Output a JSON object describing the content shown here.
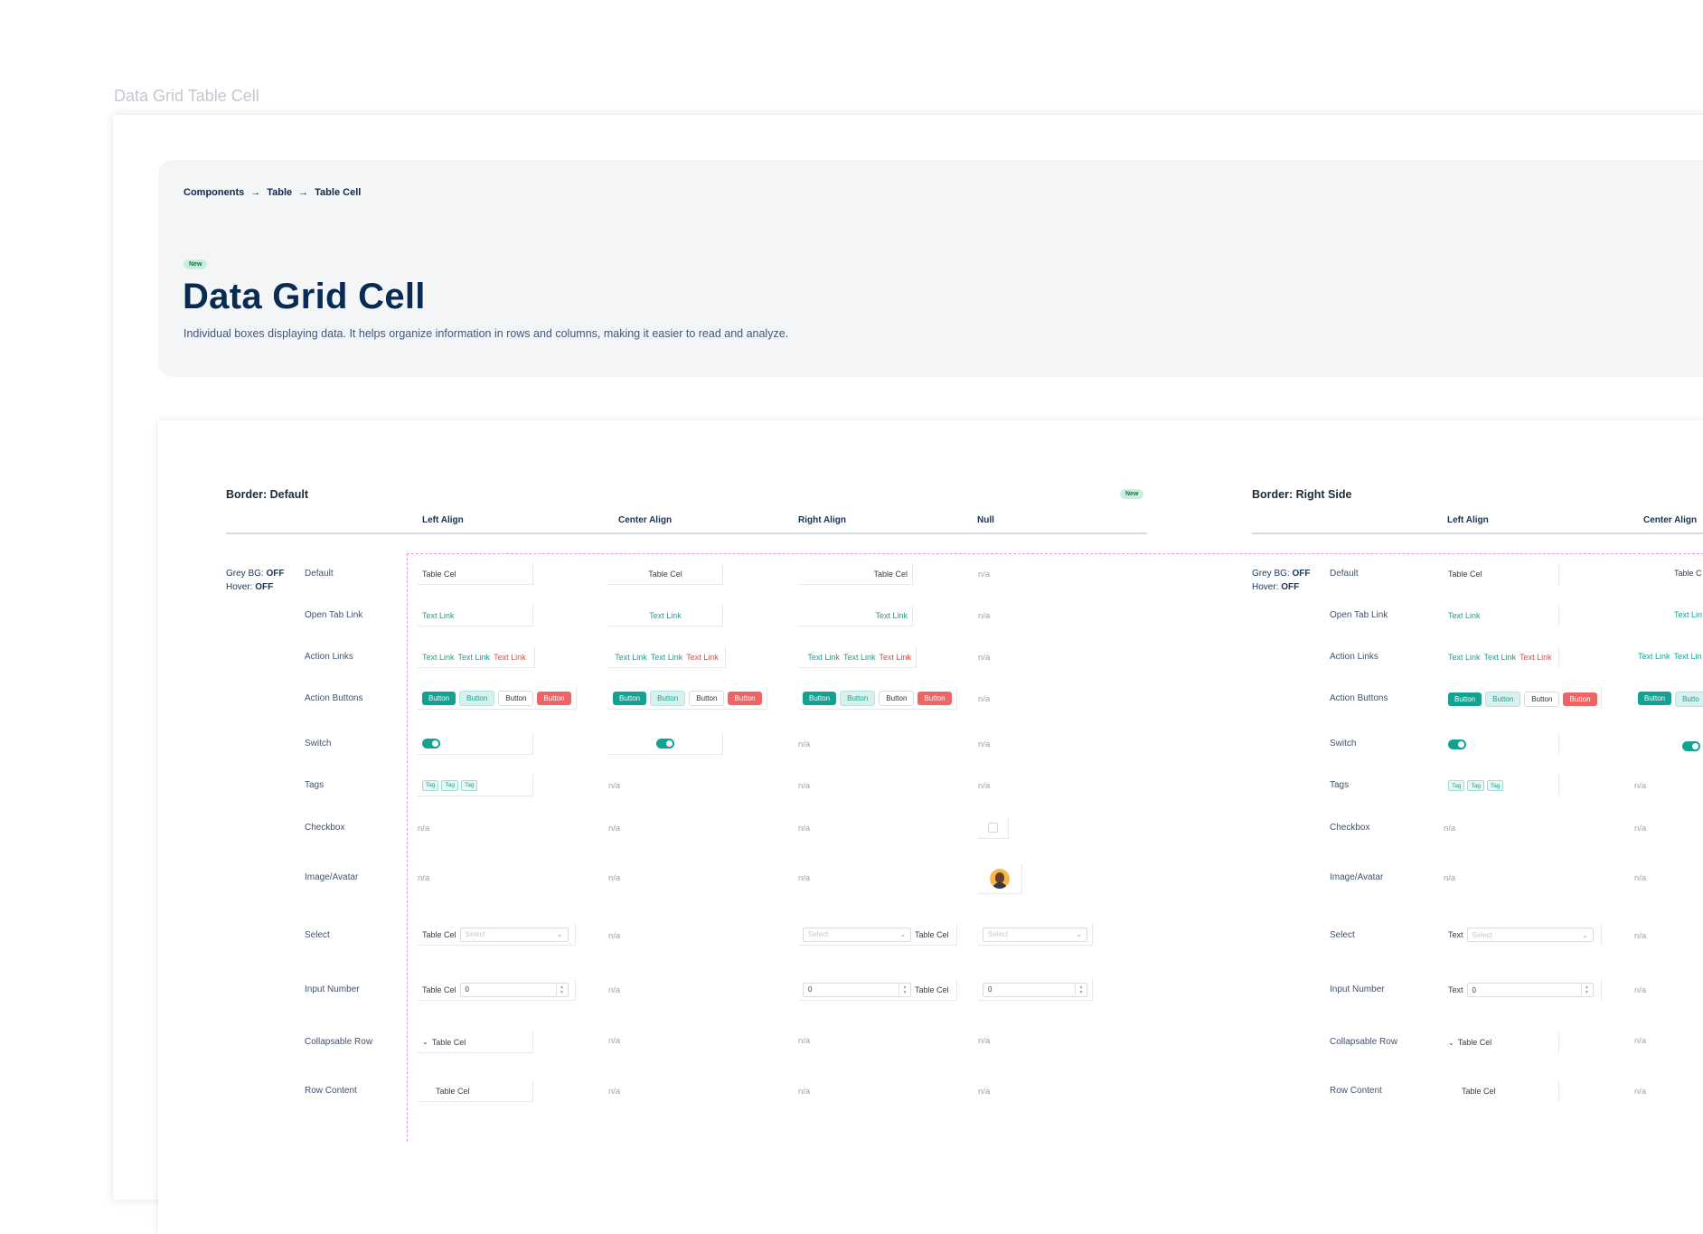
{
  "frame_title": "Data Grid Table Cell",
  "breadcrumb": [
    "Components",
    "Table",
    "Table Cell"
  ],
  "breadcrumb_sep": "→",
  "hero": {
    "badge": "New",
    "title": "Data Grid Cell",
    "description": "Individual boxes displaying data. It helps organize information in rows and columns, making it easier to read and analyze."
  },
  "colors": {
    "accent": "#13a292",
    "danger": "#ef6464",
    "navy": "#082b53"
  },
  "sections": {
    "left": {
      "title": "Border: Default",
      "badge": "New",
      "columns": [
        "Left Align",
        "Center Align",
        "Right Align",
        "Null"
      ]
    },
    "right": {
      "title": "Border: Right Side",
      "columns": [
        "Left Align",
        "Center Align"
      ]
    }
  },
  "state": {
    "grey_label": "Grey BG:",
    "grey_value": "OFF",
    "hover_label": "Hover:",
    "hover_value": "OFF"
  },
  "rows": [
    "Default",
    "Open Tab Link",
    "Action Links",
    "Action Buttons",
    "Switch",
    "Tags",
    "Checkbox",
    "Image/Avatar",
    "Select",
    "Input Number",
    "Collapsable Row",
    "Row Content"
  ],
  "cell": {
    "text": "Table Cel",
    "text_short": "Text",
    "truncated_text": "Table C",
    "link": "Text Link",
    "link_truncated": "Text Lin",
    "button": "Button",
    "button_truncated": "Butto",
    "tag": "Tag",
    "select_placeholder": "Select",
    "number_value": "0",
    "na": "n/a"
  },
  "icons": {
    "arrow": "arrow-right-icon",
    "chevron_down": "chevron-down-icon",
    "spinner": "spinner-arrows-icon",
    "avatar": "avatar-image"
  }
}
